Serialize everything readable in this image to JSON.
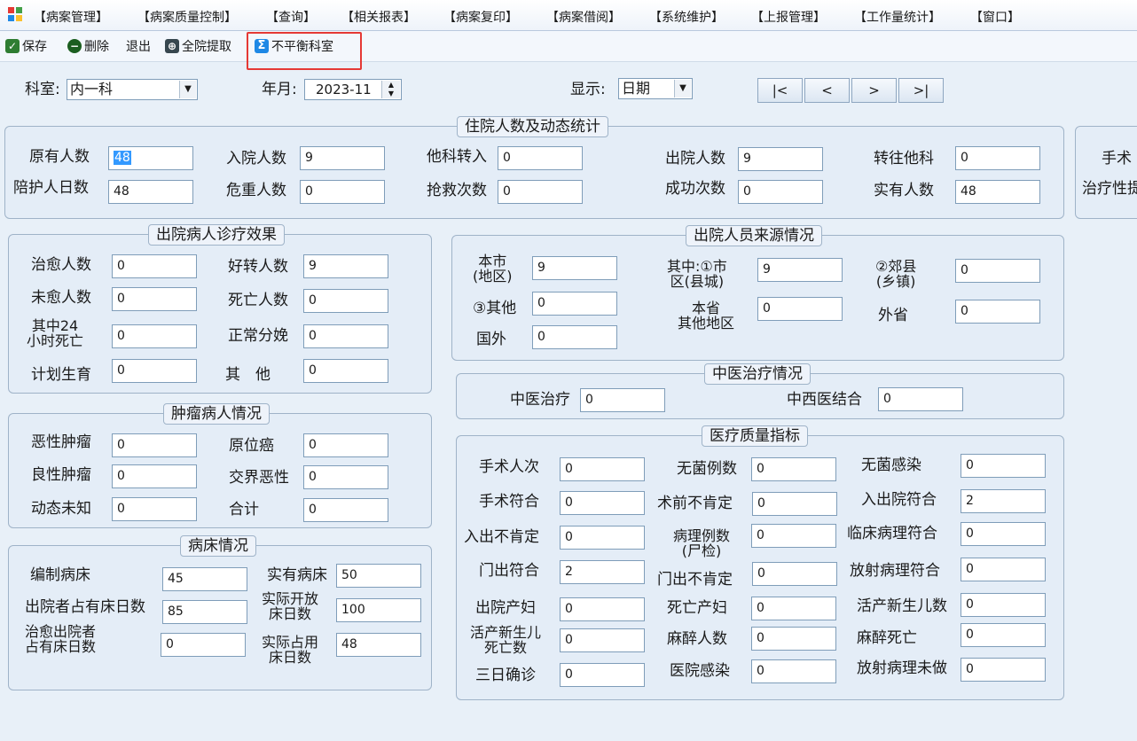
{
  "menu": [
    "【病案管理】",
    "【病案质量控制】",
    "【查询】",
    "【相关报表】",
    "【病案复印】",
    "【病案借阅】",
    "【系统维护】",
    "【上报管理】",
    "【工作量统计】",
    "【窗口】"
  ],
  "toolbar": {
    "save": "保存",
    "delete": "删除",
    "exit": "退出",
    "extract": "全院提取",
    "unbalanced": "不平衡科室"
  },
  "filter": {
    "dept_label": "科室:",
    "dept_value": "内一科",
    "month_label": "年月:",
    "month_value": "2023-11",
    "display_label": "显示:",
    "display_value": "日期",
    "nav": [
      "|<",
      "<",
      ">",
      ">|"
    ]
  },
  "inpatient": {
    "title": "住院人数及动态统计",
    "fields": [
      {
        "label": "原有人数",
        "value": "48"
      },
      {
        "label": "入院人数",
        "value": "9"
      },
      {
        "label": "他科转入",
        "value": "0"
      },
      {
        "label": "出院人数",
        "value": "9"
      },
      {
        "label": "转往他科",
        "value": "0"
      },
      {
        "label": "陪护人日数",
        "value": "48"
      },
      {
        "label": "危重人数",
        "value": "0"
      },
      {
        "label": "抢救次数",
        "value": "0"
      },
      {
        "label": "成功次数",
        "value": "0"
      },
      {
        "label": "实有人数",
        "value": "48"
      }
    ]
  },
  "right_partial": {
    "label1": "手术",
    "label2": "治疗性提"
  },
  "outcome": {
    "title": "出院病人诊疗效果",
    "fields": [
      {
        "label": "治愈人数",
        "value": "0"
      },
      {
        "label": "好转人数",
        "value": "9"
      },
      {
        "label": "未愈人数",
        "value": "0"
      },
      {
        "label": "死亡人数",
        "value": "0"
      },
      {
        "label1": "其中24",
        "label2": "小时死亡",
        "value": "0"
      },
      {
        "label": "正常分娩",
        "value": "0"
      },
      {
        "label": "计划生育",
        "value": "0"
      },
      {
        "label": "其　他",
        "value": "0"
      }
    ]
  },
  "source": {
    "title": "出院人员来源情况",
    "fields": [
      {
        "label1": "本市",
        "label2": "(地区)",
        "value": "9"
      },
      {
        "label1": "其中:①市",
        "label2": "区(县城)",
        "value": "9"
      },
      {
        "label1": "②郊县",
        "label2": "(乡镇)",
        "value": "0"
      },
      {
        "label": "③其他",
        "value": "0"
      },
      {
        "label1": "本省",
        "label2": "其他地区",
        "value": "0"
      },
      {
        "label": "外省",
        "value": "0"
      },
      {
        "label": "国外",
        "value": "0"
      }
    ]
  },
  "tcm": {
    "title": "中医治疗情况",
    "fields": [
      {
        "label": "中医治疗",
        "value": "0"
      },
      {
        "label": "中西医结合",
        "value": "0"
      }
    ]
  },
  "tumor": {
    "title": "肿瘤病人情况",
    "fields": [
      {
        "label": "恶性肿瘤",
        "value": "0"
      },
      {
        "label": "原位癌",
        "value": "0"
      },
      {
        "label": "良性肿瘤",
        "value": "0"
      },
      {
        "label": "交界恶性",
        "value": "0"
      },
      {
        "label": "动态未知",
        "value": "0"
      },
      {
        "label": "合计",
        "value": "0"
      }
    ]
  },
  "quality": {
    "title": "医疗质量指标",
    "fields": [
      {
        "label": "手术人次",
        "value": "0"
      },
      {
        "label": "无菌例数",
        "value": "0"
      },
      {
        "label": "无菌感染",
        "value": "0"
      },
      {
        "label": "手术符合",
        "value": "0"
      },
      {
        "label": "术前不肯定",
        "value": "0"
      },
      {
        "label": "入出院符合",
        "value": "2"
      },
      {
        "label": "入出不肯定",
        "value": "0"
      },
      {
        "label1": "病理例数",
        "label2": "(尸检)",
        "value": "0"
      },
      {
        "label": "临床病理符合",
        "value": "0"
      },
      {
        "label": "门出符合",
        "value": "2"
      },
      {
        "label": "门出不肯定",
        "value": "0"
      },
      {
        "label": "放射病理符合",
        "value": "0"
      },
      {
        "label": "出院产妇",
        "value": "0"
      },
      {
        "label": "死亡产妇",
        "value": "0"
      },
      {
        "label": "活产新生儿数",
        "value": "0"
      },
      {
        "label1": "活产新生儿",
        "label2": "死亡数",
        "value": "0"
      },
      {
        "label": "麻醉人数",
        "value": "0"
      },
      {
        "label": "麻醉死亡",
        "value": "0"
      },
      {
        "label": "三日确诊",
        "value": "0"
      },
      {
        "label": "医院感染",
        "value": "0"
      },
      {
        "label": "放射病理未做",
        "value": "0"
      }
    ]
  },
  "beds": {
    "title": "病床情况",
    "fields": [
      {
        "label": "编制病床",
        "value": "45"
      },
      {
        "label": "实有病床",
        "value": "50"
      },
      {
        "label": "出院者占有床日数",
        "value": "85"
      },
      {
        "label1": "实际开放",
        "label2": "床日数",
        "value": "100"
      },
      {
        "label1": "治愈出院者",
        "label2": "占有床日数",
        "value": "0"
      },
      {
        "label1": "实际占用",
        "label2": "床日数",
        "value": "48"
      }
    ]
  }
}
